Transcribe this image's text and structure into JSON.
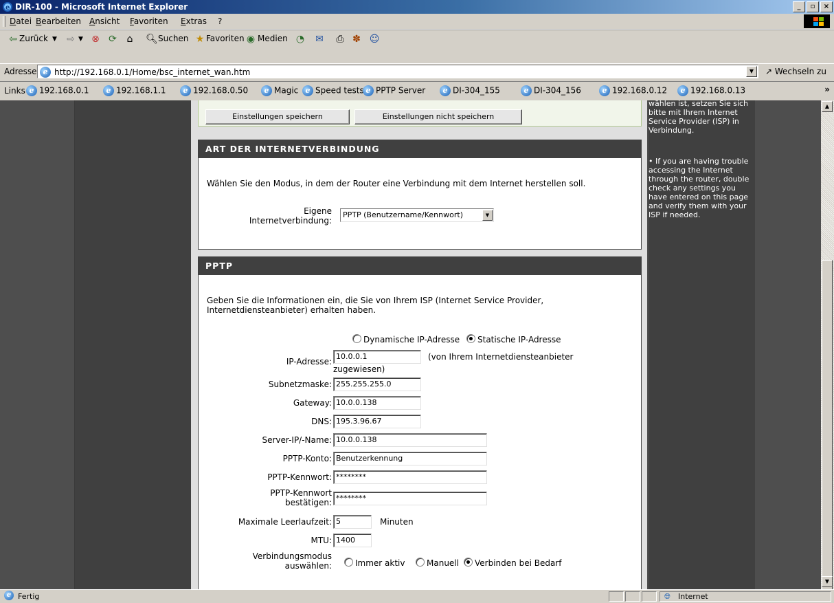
{
  "window": {
    "title": "DIR-100 - Microsoft Internet Explorer"
  },
  "menu": [
    "Datei",
    "Bearbeiten",
    "Ansicht",
    "Favoriten",
    "Extras",
    "?"
  ],
  "toolbar": {
    "back": "Zurück",
    "search": "Suchen",
    "favorites": "Favoriten",
    "media": "Medien"
  },
  "address": {
    "label": "Adresse",
    "url": "http://192.168.0.1/Home/bsc_internet_wan.htm",
    "go": "Wechseln zu"
  },
  "links": {
    "label": "Links",
    "items": [
      "192.168.0.1",
      "192.168.1.1",
      "192.168.0.50",
      "Magic",
      "Speed tests",
      "PPTP Server",
      "DI-304_155",
      "DI-304_156",
      "192.168.0.12",
      "192.168.0.13"
    ]
  },
  "buttons": {
    "save": "Einstellungen speichern",
    "dont_save": "Einstellungen nicht speichern"
  },
  "connection_type": {
    "heading": "ART DER INTERNETVERBINDUNG",
    "intro": "Wählen Sie den Modus, in dem der Router eine Verbindung mit dem Internet herstellen soll.",
    "label_line1": "Eigene",
    "label_line2": "Internetverbindung:",
    "selected": "PPTP (Benutzername/Kennwort)"
  },
  "pptp": {
    "heading": "PPTP",
    "intro_line1": "Geben Sie die Informationen ein, die Sie von Ihrem ISP (Internet Service Provider,",
    "intro_line2": "Internetdiensteanbieter) erhalten haben.",
    "mode_dynamic": "Dynamische IP-Adresse",
    "mode_static": "Statische IP-Adresse",
    "mode_selected": "static",
    "ip_label": "IP-Adresse:",
    "ip_value": "10.0.0.1",
    "ip_note_line1": "(von Ihrem Internetdiensteanbieter",
    "ip_note_line2": "zugewiesen)",
    "subnet_label": "Subnetzmaske:",
    "subnet_value": "255.255.255.0",
    "gateway_label": "Gateway:",
    "gateway_value": "10.0.0.138",
    "dns_label": "DNS:",
    "dns_value": "195.3.96.67",
    "server_label": "Server-IP/-Name:",
    "server_value": "10.0.0.138",
    "account_label": "PPTP-Konto:",
    "account_value": "Benutzerkennung",
    "password_label": "PPTP-Kennwort:",
    "password_value": "********",
    "confirm_label_line1": "PPTP-Kennwort",
    "confirm_label_line2": "bestätigen:",
    "confirm_value": "********",
    "idle_label": "Maximale Leerlaufzeit:",
    "idle_value": "5",
    "idle_unit": "Minuten",
    "mtu_label": "MTU:",
    "mtu_value": "1400",
    "connmode_label_line1": "Verbindungsmodus",
    "connmode_label_line2": "auswählen:",
    "connmode_always": "Immer aktiv",
    "connmode_manual": "Manuell",
    "connmode_ondemand": "Verbinden bei Bedarf",
    "connmode_selected": "ondemand"
  },
  "help": {
    "p1": "wählen ist, setzen Sie sich bitte mit Ihrem Internet Service Provider (ISP) in Verbindung.",
    "p2": "• If you are having trouble accessing the Internet through the router, double check any settings you have entered on this page and verify them with your ISP if needed."
  },
  "status": {
    "text": "Fertig",
    "zone": "Internet"
  }
}
